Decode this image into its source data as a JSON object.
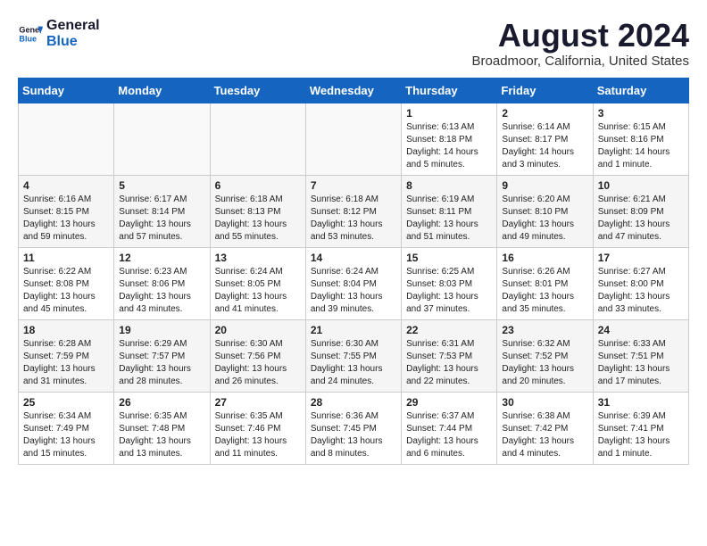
{
  "header": {
    "logo_line1": "General",
    "logo_line2": "Blue",
    "month_title": "August 2024",
    "location": "Broadmoor, California, United States"
  },
  "weekdays": [
    "Sunday",
    "Monday",
    "Tuesday",
    "Wednesday",
    "Thursday",
    "Friday",
    "Saturday"
  ],
  "weeks": [
    [
      {
        "day": "",
        "info": ""
      },
      {
        "day": "",
        "info": ""
      },
      {
        "day": "",
        "info": ""
      },
      {
        "day": "",
        "info": ""
      },
      {
        "day": "1",
        "info": "Sunrise: 6:13 AM\nSunset: 8:18 PM\nDaylight: 14 hours\nand 5 minutes."
      },
      {
        "day": "2",
        "info": "Sunrise: 6:14 AM\nSunset: 8:17 PM\nDaylight: 14 hours\nand 3 minutes."
      },
      {
        "day": "3",
        "info": "Sunrise: 6:15 AM\nSunset: 8:16 PM\nDaylight: 14 hours\nand 1 minute."
      }
    ],
    [
      {
        "day": "4",
        "info": "Sunrise: 6:16 AM\nSunset: 8:15 PM\nDaylight: 13 hours\nand 59 minutes."
      },
      {
        "day": "5",
        "info": "Sunrise: 6:17 AM\nSunset: 8:14 PM\nDaylight: 13 hours\nand 57 minutes."
      },
      {
        "day": "6",
        "info": "Sunrise: 6:18 AM\nSunset: 8:13 PM\nDaylight: 13 hours\nand 55 minutes."
      },
      {
        "day": "7",
        "info": "Sunrise: 6:18 AM\nSunset: 8:12 PM\nDaylight: 13 hours\nand 53 minutes."
      },
      {
        "day": "8",
        "info": "Sunrise: 6:19 AM\nSunset: 8:11 PM\nDaylight: 13 hours\nand 51 minutes."
      },
      {
        "day": "9",
        "info": "Sunrise: 6:20 AM\nSunset: 8:10 PM\nDaylight: 13 hours\nand 49 minutes."
      },
      {
        "day": "10",
        "info": "Sunrise: 6:21 AM\nSunset: 8:09 PM\nDaylight: 13 hours\nand 47 minutes."
      }
    ],
    [
      {
        "day": "11",
        "info": "Sunrise: 6:22 AM\nSunset: 8:08 PM\nDaylight: 13 hours\nand 45 minutes."
      },
      {
        "day": "12",
        "info": "Sunrise: 6:23 AM\nSunset: 8:06 PM\nDaylight: 13 hours\nand 43 minutes."
      },
      {
        "day": "13",
        "info": "Sunrise: 6:24 AM\nSunset: 8:05 PM\nDaylight: 13 hours\nand 41 minutes."
      },
      {
        "day": "14",
        "info": "Sunrise: 6:24 AM\nSunset: 8:04 PM\nDaylight: 13 hours\nand 39 minutes."
      },
      {
        "day": "15",
        "info": "Sunrise: 6:25 AM\nSunset: 8:03 PM\nDaylight: 13 hours\nand 37 minutes."
      },
      {
        "day": "16",
        "info": "Sunrise: 6:26 AM\nSunset: 8:01 PM\nDaylight: 13 hours\nand 35 minutes."
      },
      {
        "day": "17",
        "info": "Sunrise: 6:27 AM\nSunset: 8:00 PM\nDaylight: 13 hours\nand 33 minutes."
      }
    ],
    [
      {
        "day": "18",
        "info": "Sunrise: 6:28 AM\nSunset: 7:59 PM\nDaylight: 13 hours\nand 31 minutes."
      },
      {
        "day": "19",
        "info": "Sunrise: 6:29 AM\nSunset: 7:57 PM\nDaylight: 13 hours\nand 28 minutes."
      },
      {
        "day": "20",
        "info": "Sunrise: 6:30 AM\nSunset: 7:56 PM\nDaylight: 13 hours\nand 26 minutes."
      },
      {
        "day": "21",
        "info": "Sunrise: 6:30 AM\nSunset: 7:55 PM\nDaylight: 13 hours\nand 24 minutes."
      },
      {
        "day": "22",
        "info": "Sunrise: 6:31 AM\nSunset: 7:53 PM\nDaylight: 13 hours\nand 22 minutes."
      },
      {
        "day": "23",
        "info": "Sunrise: 6:32 AM\nSunset: 7:52 PM\nDaylight: 13 hours\nand 20 minutes."
      },
      {
        "day": "24",
        "info": "Sunrise: 6:33 AM\nSunset: 7:51 PM\nDaylight: 13 hours\nand 17 minutes."
      }
    ],
    [
      {
        "day": "25",
        "info": "Sunrise: 6:34 AM\nSunset: 7:49 PM\nDaylight: 13 hours\nand 15 minutes."
      },
      {
        "day": "26",
        "info": "Sunrise: 6:35 AM\nSunset: 7:48 PM\nDaylight: 13 hours\nand 13 minutes."
      },
      {
        "day": "27",
        "info": "Sunrise: 6:35 AM\nSunset: 7:46 PM\nDaylight: 13 hours\nand 11 minutes."
      },
      {
        "day": "28",
        "info": "Sunrise: 6:36 AM\nSunset: 7:45 PM\nDaylight: 13 hours\nand 8 minutes."
      },
      {
        "day": "29",
        "info": "Sunrise: 6:37 AM\nSunset: 7:44 PM\nDaylight: 13 hours\nand 6 minutes."
      },
      {
        "day": "30",
        "info": "Sunrise: 6:38 AM\nSunset: 7:42 PM\nDaylight: 13 hours\nand 4 minutes."
      },
      {
        "day": "31",
        "info": "Sunrise: 6:39 AM\nSunset: 7:41 PM\nDaylight: 13 hours\nand 1 minute."
      }
    ]
  ]
}
